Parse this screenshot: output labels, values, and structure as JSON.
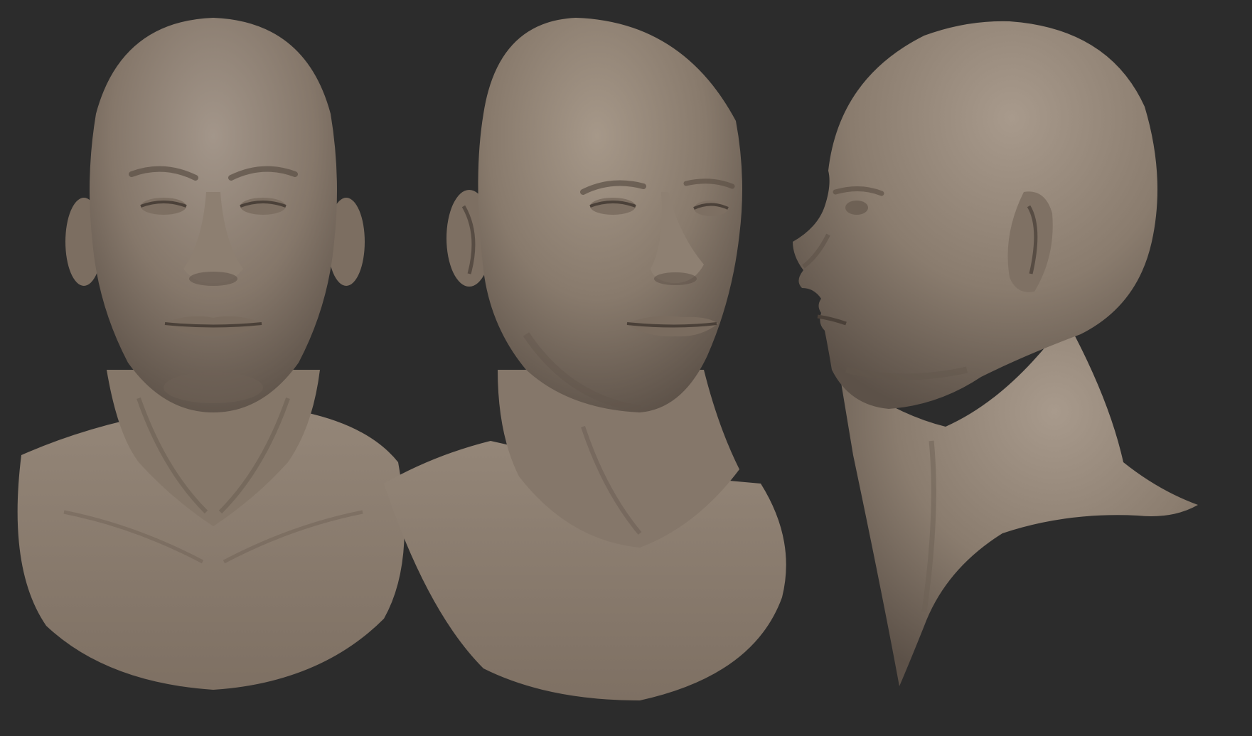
{
  "scene": {
    "background_color": "#2c2c2c",
    "sculpt_material_color": "#877769",
    "sculpt_highlight_color": "#a99a8c",
    "sculpt_shadow_color": "#4d433b",
    "views": [
      {
        "id": "front",
        "label": ""
      },
      {
        "id": "three-quarter",
        "label": ""
      },
      {
        "id": "profile",
        "label": ""
      }
    ]
  }
}
